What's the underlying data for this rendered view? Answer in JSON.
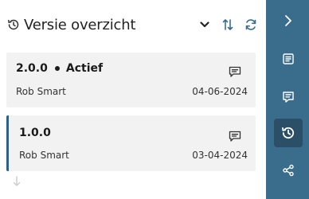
{
  "header": {
    "title": "Versie overzicht",
    "icons": [
      "history-icon",
      "chevron-down-icon",
      "sort-icon",
      "refresh-icon"
    ]
  },
  "versions": [
    {
      "version": "2.0.0",
      "status": "Actief",
      "author": "Rob Smart",
      "date": "04-06-2024",
      "selected": false
    },
    {
      "version": "1.0.0",
      "status": "",
      "author": "Rob Smart",
      "date": "03-04-2024",
      "selected": true
    }
  ],
  "sidebar": {
    "items": [
      {
        "icon": "chevron-right-icon",
        "active": false
      },
      {
        "icon": "document-icon",
        "active": false
      },
      {
        "icon": "comment-icon",
        "active": false
      },
      {
        "icon": "history-icon",
        "active": true
      },
      {
        "icon": "share-icon",
        "active": false
      }
    ]
  },
  "colors": {
    "accent": "#3a6d8c",
    "accent_active": "#2a4f66",
    "card_background": "#f2f2f2",
    "selected_border": "#2c6285"
  }
}
